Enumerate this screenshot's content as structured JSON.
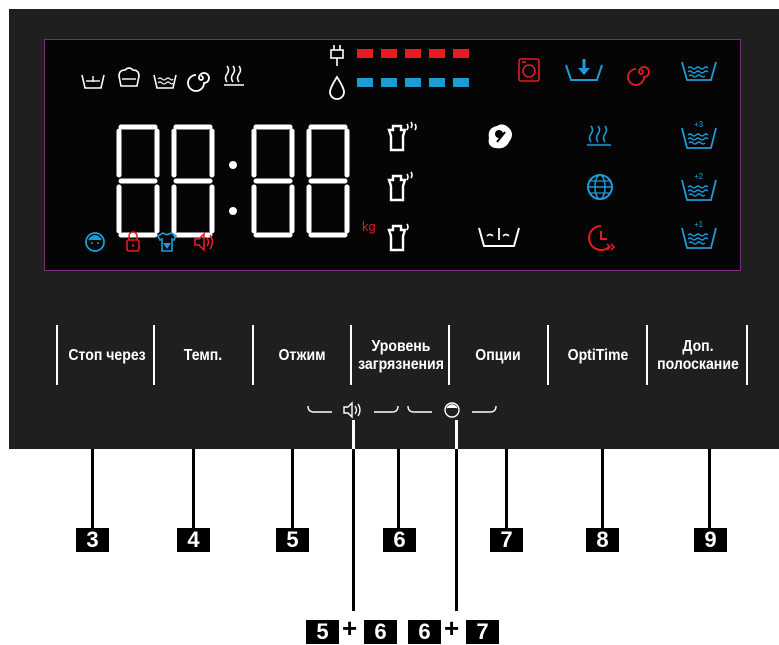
{
  "display": {
    "digits": "88:88",
    "unit": "kg",
    "bar_colors": {
      "temperature": "#e51b24",
      "water": "#1e9bd7"
    },
    "display_icons_top": [
      "prewash-icon",
      "intensive-icon",
      "wash-icon",
      "spin-icon",
      "steam-icon"
    ],
    "status_icons": [
      "child-lock-icon",
      "door-lock-icon",
      "add-garment-icon",
      "sound-icon"
    ],
    "accent_red": "#e51b24",
    "accent_blue": "#1e9bd7"
  },
  "buttons": [
    {
      "id": "3",
      "label": "Стоп через"
    },
    {
      "id": "4",
      "label": "Темп."
    },
    {
      "id": "5",
      "label": "Отжим"
    },
    {
      "id": "6",
      "label": "Уровень загрязнения"
    },
    {
      "id": "7",
      "label": "Опции"
    },
    {
      "id": "8",
      "label": "OptiTime"
    },
    {
      "id": "9",
      "label": "Доп. полоскание"
    }
  ],
  "callouts": {
    "numbers": [
      "3",
      "4",
      "5",
      "6",
      "7",
      "8",
      "9"
    ],
    "combo1": {
      "a": "5",
      "b": "6",
      "plus": "+"
    },
    "combo2": {
      "a": "6",
      "b": "7",
      "plus": "+"
    }
  },
  "rinse_marks": {
    "r3": "+3",
    "r2": "+2",
    "r1": "+1"
  }
}
